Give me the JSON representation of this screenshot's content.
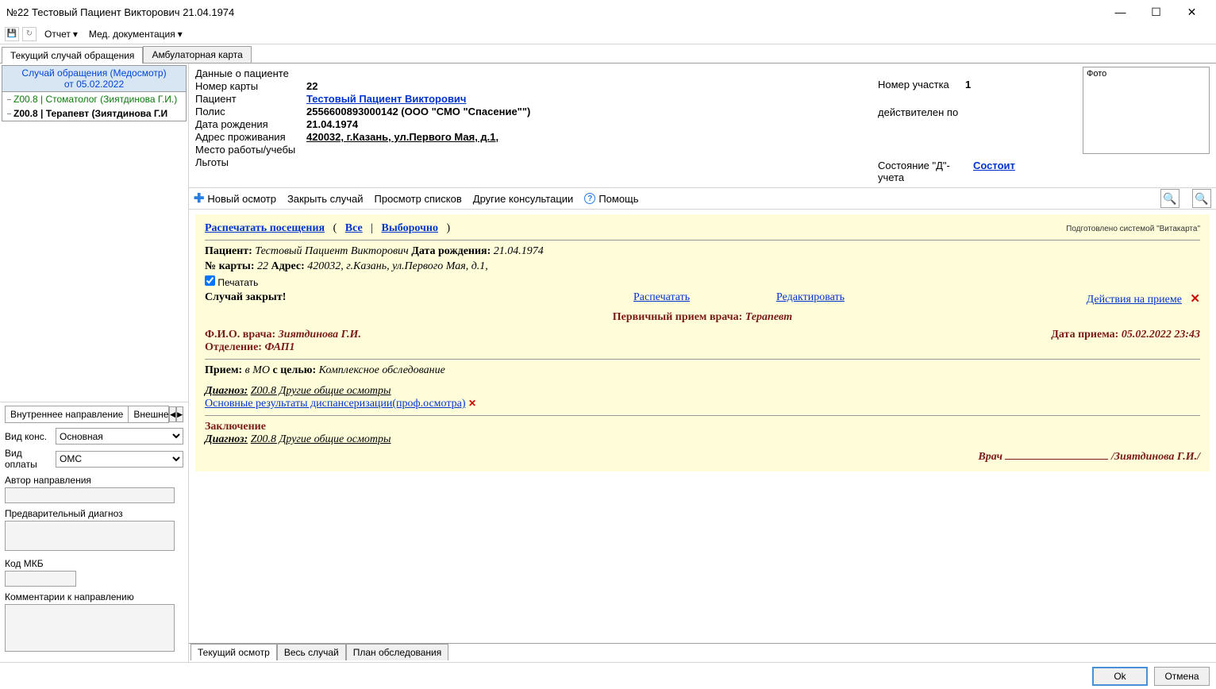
{
  "window": {
    "title": "№22 Тестовый Пациент Викторович 21.04.1974"
  },
  "menu": {
    "report": "Отчет",
    "docs": "Мед. документация"
  },
  "mainTabs": {
    "current": "Текущий случай обращения",
    "amb": "Амбулаторная карта"
  },
  "caseTree": {
    "header1": "Случай обращения (Медосмотр)",
    "header2": "от 05.02.2022",
    "item1": "Z00.8 | Стоматолог (Зиятдинова Г.И.)",
    "item2": "Z00.8 | Терапевт (Зиятдинова Г.И"
  },
  "referral": {
    "tabInternal": "Внутреннее направление",
    "tabExternal": "Внешнее на",
    "consTypeLabel": "Вид конс.",
    "consTypeValue": "Основная",
    "payTypeLabel": "Вид оплаты",
    "payTypeValue": "ОМС",
    "authorLabel": "Автор направления",
    "prelimLabel": "Предварительный диагноз",
    "mkbLabel": "Код МКБ",
    "commentsLabel": "Комментарии к направлению"
  },
  "patient": {
    "section": "Данные о пациенте",
    "cardNoLabel": "Номер карты",
    "cardNo": "22",
    "nameLabel": "Пациент",
    "name": "Тестовый Пациент Викторович",
    "policyLabel": "Полис",
    "policy": "2556600893000142 (ООО \"СМО \"Спасение\"\")",
    "dobLabel": "Дата рождения",
    "dob": "21.04.1974",
    "addrLabel": "Адрес проживания",
    "addr": "420032, г.Казань, ул.Первого Мая, д.1,",
    "workLabel": "Место работы/учебы",
    "benefitsLabel": "Льготы",
    "sectorLabel": "Номер участка",
    "sector": "1",
    "validLabel": "действителен по",
    "dstateLabel": "Состояние \"Д\"-учета",
    "dstateLink": "Состоит",
    "photoLabel": "Фото"
  },
  "toolbar": {
    "newExam": "Новый осмотр",
    "closeCase": "Закрыть случай",
    "viewLists": "Просмотр списков",
    "otherCons": "Другие консультации",
    "help": "Помощь"
  },
  "doc": {
    "printVisits": "Распечатать посещения",
    "all": "Все",
    "selective": "Выборочно",
    "sysnote": "Подготовлено системой \"Витакарта\"",
    "patLabel": "Пациент:",
    "patName": "Тестовый Пациент Викторович",
    "dobLabel": "Дата рождения:",
    "dob": "21.04.1974",
    "cardLabel": "№ карты:",
    "card": "22",
    "addrLabel": "Адрес:",
    "addr": "420032, г.Казань, ул.Первого Мая, д.1,",
    "printChk": "Печатать",
    "caseClosed": "Случай закрыт!",
    "printLink": "Распечатать",
    "editLink": "Редактировать",
    "actionsLink": "Действия на приеме",
    "visitTitle": "Первичный прием врача:",
    "visitSpec": "Терапевт",
    "docFioLabel": "Ф.И.О. врача:",
    "docFio": "Зиятдинова Г.И.",
    "dateLabel": "Дата приема:",
    "date": "05.02.2022 23:43",
    "deptLabel": "Отделение:",
    "dept": "ФАП1",
    "visitLabel": "Прием:",
    "visitWhere": "в МО",
    "visitGoalLabel": "с целью:",
    "visitGoal": "Комплексное обследование",
    "diagLabel": "Диагноз:",
    "diag": "Z00.8 Другие общие осмотры",
    "dispLink": "Основные результаты диспансеризации(проф.осмотра)",
    "concl": "Заключение",
    "doctorSig": "Врач",
    "doctorName": "/Зиятдинова Г.И./"
  },
  "bottomTabs": {
    "current": "Текущий осмотр",
    "whole": "Весь случай",
    "plan": "План обследования"
  },
  "footer": {
    "ok": "Ok",
    "cancel": "Отмена"
  }
}
